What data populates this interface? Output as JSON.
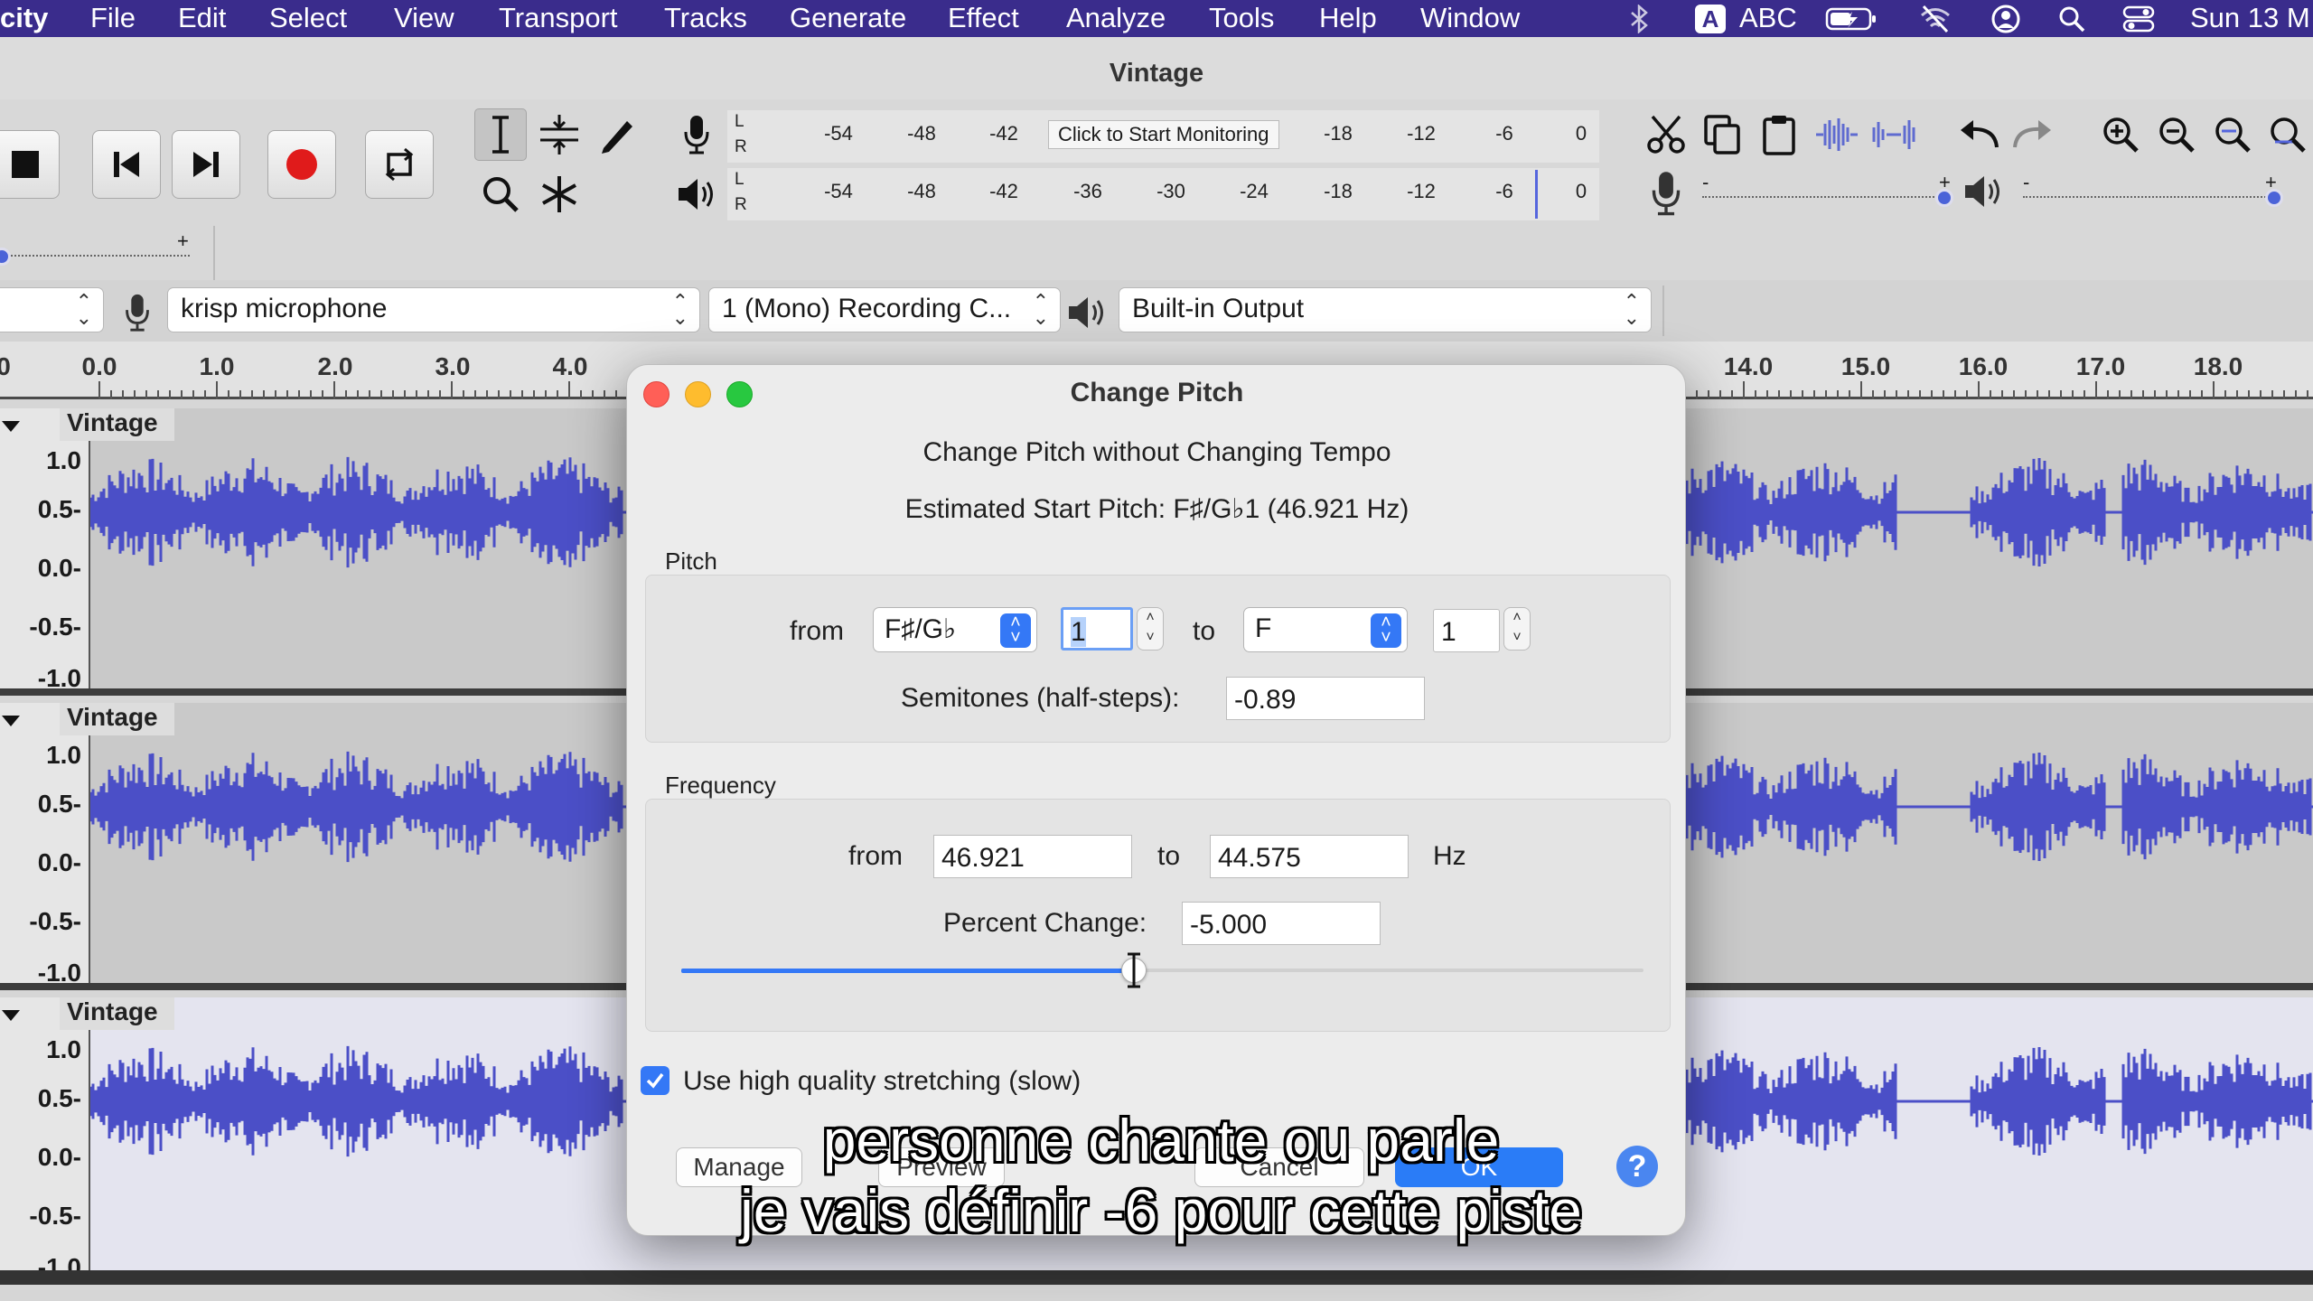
{
  "menubar": {
    "app": "city",
    "items": [
      "File",
      "Edit",
      "Select",
      "View",
      "Transport",
      "Tracks",
      "Generate",
      "Effect",
      "Analyze",
      "Tools",
      "Help",
      "Window"
    ],
    "input_source": "ABC",
    "clock": "Sun 13 M",
    "icons": [
      "bluetooth-icon",
      "keyboard-a-icon",
      "battery-charging-icon",
      "wifi-off-icon",
      "user-account-icon",
      "spotlight-search-icon",
      "control-center-icon"
    ]
  },
  "window": {
    "title": "Vintage"
  },
  "toolbar": {
    "transport_icons": [
      "stop-icon",
      "skip-to-start-icon",
      "skip-to-end-icon",
      "record-icon",
      "loop-icon"
    ],
    "tool_icons": [
      "selection-tool-icon",
      "envelope-tool-icon",
      "draw-tool-icon",
      "zoom-tool-icon",
      "multi-tool-icon"
    ],
    "record_meter": {
      "ticks": [
        "-54",
        "-48",
        "-42",
        "-18",
        "-12",
        "-6",
        "0"
      ],
      "monitor_label": "Click to Start Monitoring"
    },
    "play_meter": {
      "ticks": [
        "-54",
        "-48",
        "-42",
        "-36",
        "-30",
        "-24",
        "-18",
        "-12",
        "-6",
        "0"
      ]
    },
    "channel_labels": [
      "L",
      "R"
    ],
    "edit_icons": [
      "cut-icon",
      "copy-icon",
      "paste-icon",
      "trim-icon",
      "silence-icon",
      "undo-icon",
      "redo-icon",
      "zoom-in-icon",
      "zoom-out-icon",
      "fit-selection-icon",
      "fit-project-icon"
    ],
    "slider_marks": [
      "-",
      "+"
    ]
  },
  "devices": {
    "mic_device": "krisp microphone",
    "channels": "1 (Mono) Recording C...",
    "output_device": "Built-in Output"
  },
  "ruler": {
    "labels_left": [
      "0.0",
      "1.0",
      "2.0",
      "3.0",
      "4.0"
    ],
    "labels_right": [
      "14.0",
      "15.0",
      "16.0",
      "17.0",
      "18.0"
    ]
  },
  "tracks": [
    {
      "name": "Vintage",
      "scale": [
        "1.0",
        "0.5-",
        "0.0-",
        "-0.5-",
        "-1.0"
      ]
    },
    {
      "name": "Vintage",
      "scale": [
        "1.0",
        "0.5-",
        "0.0-",
        "-0.5-",
        "-1.0"
      ]
    },
    {
      "name": "Vintage",
      "scale": [
        "1.0",
        "0.5-",
        "0.0-",
        "-0.5-",
        "-1.0"
      ]
    }
  ],
  "dialog": {
    "title": "Change Pitch",
    "heading": "Change Pitch without Changing Tempo",
    "estimated": "Estimated Start Pitch: F♯/G♭1 (46.921 Hz)",
    "pitch_group": "Pitch",
    "from_label": "from",
    "to_label": "to",
    "from_note": "F♯/G♭",
    "from_octave": "1",
    "to_note": "F",
    "to_octave": "1",
    "semitones_label": "Semitones (half-steps):",
    "semitones_value": "-0.89",
    "frequency_group": "Frequency",
    "freq_from": "46.921",
    "freq_to": "44.575",
    "hz_label": "Hz",
    "percent_label": "Percent Change:",
    "percent_value": "-5.000",
    "slider_fraction": 0.47,
    "hq_label": "Use high quality stretching (slow)",
    "hq_checked": true,
    "buttons": {
      "manage": "Manage",
      "preview": "Preview",
      "cancel": "Cancel",
      "ok": "OK",
      "help": "?"
    }
  },
  "subtitles": {
    "line1": "personne chante ou parle",
    "line2": "je vais définir -6 pour cette piste"
  },
  "colors": {
    "menubar": "#3a2c8c",
    "wave": "#4b4fc7",
    "accent": "#3478f6",
    "record": "#e01b1b"
  }
}
